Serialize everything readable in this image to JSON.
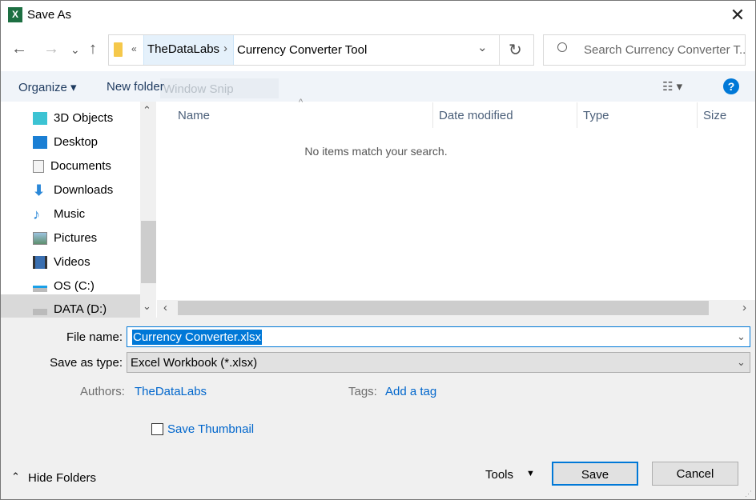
{
  "window": {
    "title": "Save As",
    "app_icon": "excel-icon",
    "close": "✕"
  },
  "nav": {
    "back": "←",
    "forward": "→",
    "recent": "⌄",
    "up": "↑"
  },
  "address": {
    "overflow": "«",
    "crumbs": [
      "TheDataLabs",
      "Currency Converter Tool"
    ],
    "sep": "›",
    "dropdown": "⌄",
    "refresh": "↻"
  },
  "search": {
    "placeholder": "Search Currency Converter T..."
  },
  "toolbar": {
    "organize": "Organize ▾",
    "new_folder": "New folder",
    "overlay_text": "Window Snip",
    "view": "☷ ▾",
    "help": "?"
  },
  "sidebar": {
    "items": [
      {
        "label": "3D Objects",
        "icon": "3d-objects-icon"
      },
      {
        "label": "Desktop",
        "icon": "desktop-icon"
      },
      {
        "label": "Documents",
        "icon": "documents-icon"
      },
      {
        "label": "Downloads",
        "icon": "downloads-icon"
      },
      {
        "label": "Music",
        "icon": "music-icon"
      },
      {
        "label": "Pictures",
        "icon": "pictures-icon"
      },
      {
        "label": "Videos",
        "icon": "videos-icon"
      },
      {
        "label": "OS (C:)",
        "icon": "drive-icon"
      },
      {
        "label": "DATA (D:)",
        "icon": "drive-icon",
        "selected": true
      }
    ]
  },
  "columns": [
    "Name",
    "Date modified",
    "Type",
    "Size"
  ],
  "empty_message": "No items match your search.",
  "form": {
    "file_name_label": "File name:",
    "file_name": "Currency Converter.xlsx",
    "type_label": "Save as type:",
    "type": "Excel Workbook (*.xlsx)",
    "authors_label": "Authors:",
    "authors": "TheDataLabs",
    "tags_label": "Tags:",
    "tags": "Add a tag",
    "thumbnail": "Save Thumbnail",
    "thumbnail_checked": false
  },
  "footer": {
    "hide_folders": "Hide Folders",
    "tools": "Tools",
    "save": "Save",
    "cancel": "Cancel"
  },
  "colors": {
    "accent": "#0078d7",
    "link": "#0066cc",
    "selection": "#0078d7"
  }
}
